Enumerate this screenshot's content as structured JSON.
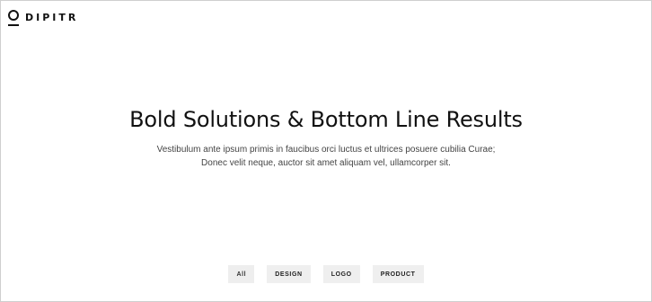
{
  "brand": {
    "name": "DIPITR",
    "logo_icon": "dipitr-logo-icon"
  },
  "hero": {
    "title": "Bold Solutions & Bottom Line Results",
    "text": "Vestibulum ante ipsum primis in faucibus orci luctus et ultrices posuere cubilia Curae; Donec velit neque, auctor sit amet aliquam vel, ullamcorper sit."
  },
  "filters": {
    "items": [
      {
        "label": "All",
        "active": true
      },
      {
        "label": "DESIGN",
        "active": false
      },
      {
        "label": "LOGO",
        "active": false
      },
      {
        "label": "PRODUCT",
        "active": false
      }
    ],
    "active_bg": "#eeeeee"
  }
}
